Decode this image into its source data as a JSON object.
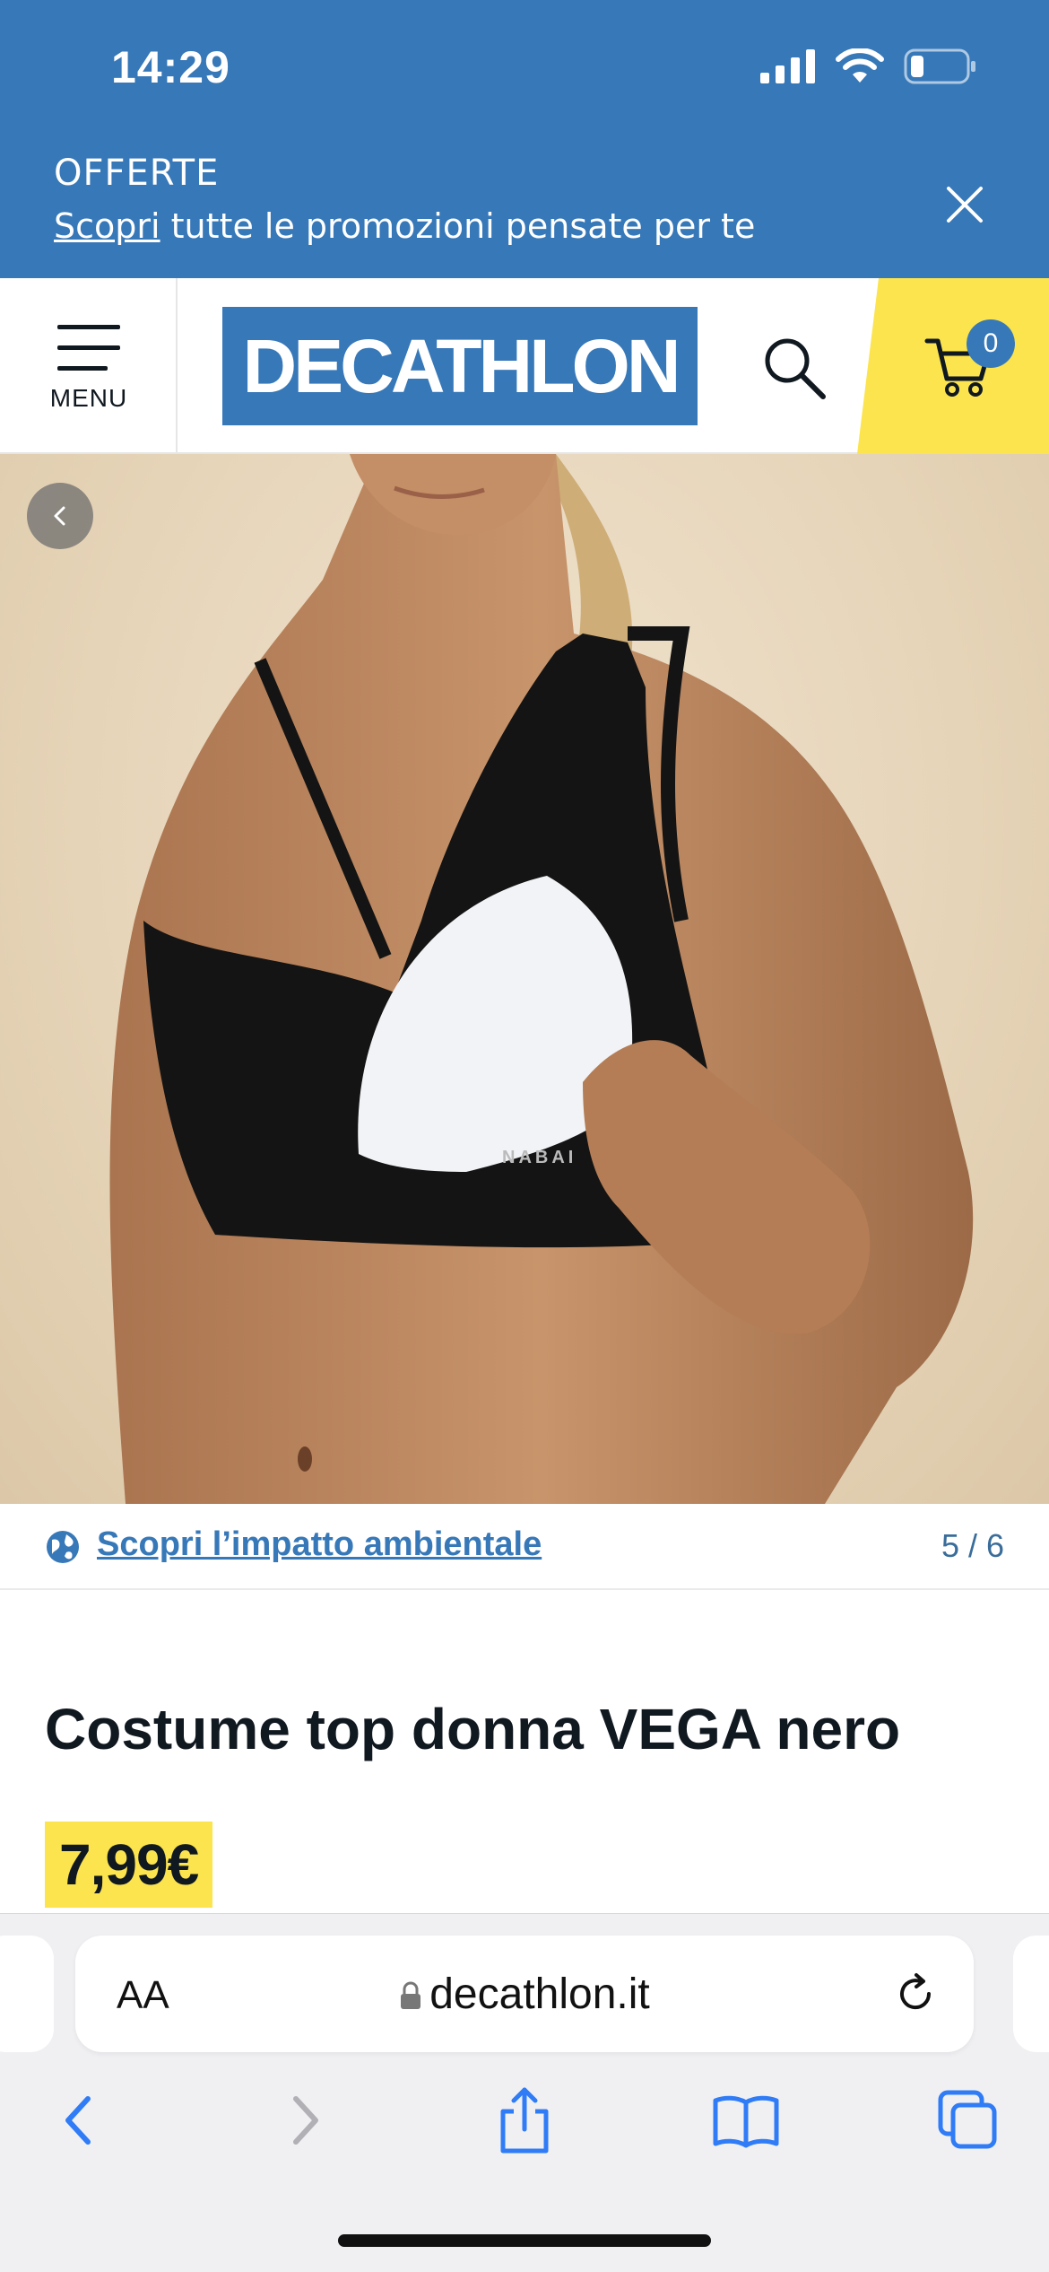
{
  "status_bar": {
    "time": "14:29"
  },
  "promo": {
    "title": "OFFERTE",
    "link": "Scopri",
    "text": " tutte le promozioni pensate per te"
  },
  "header": {
    "menu_label": "MENU",
    "logo": "DECATHLON",
    "cart_count": "0"
  },
  "gallery": {
    "impact_link": "Scopri l’impatto ambientale",
    "counter": "5 / 6",
    "bra_print": "NABAI"
  },
  "product": {
    "title": "Costume top donna VEGA nero",
    "price": "7,99€"
  },
  "browser": {
    "text_size": "AA",
    "url": "decathlon.it"
  },
  "colors": {
    "brand_blue": "#3778b8",
    "accent_yellow": "#fbe44d",
    "text_dark": "#101820"
  },
  "icons": [
    "signal-icon",
    "wifi-icon",
    "battery-icon",
    "close-icon",
    "menu-icon",
    "search-icon",
    "cart-icon",
    "chevron-left-icon",
    "globe-icon",
    "lock-icon",
    "reload-icon",
    "back-icon",
    "forward-icon",
    "share-icon",
    "bookmarks-icon",
    "tabs-icon"
  ]
}
